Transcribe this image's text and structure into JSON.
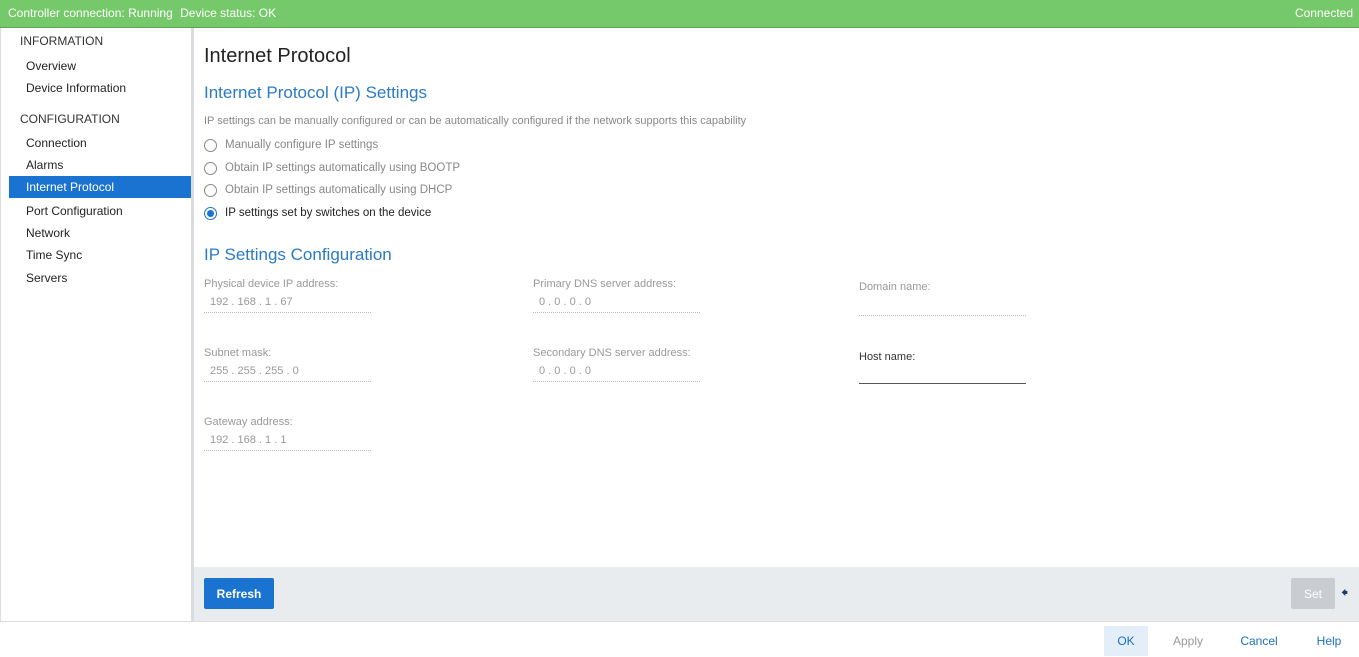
{
  "status": {
    "controller": "Controller connection: Running",
    "device": "Device status: OK",
    "connection": "Connected"
  },
  "sidebar": {
    "information_header": "INFORMATION",
    "configuration_header": "CONFIGURATION",
    "info_items": [
      {
        "label": "Overview"
      },
      {
        "label": "Device Information"
      }
    ],
    "config_items": [
      {
        "label": "Connection"
      },
      {
        "label": "Alarms"
      },
      {
        "label": "Internet Protocol",
        "active": true
      },
      {
        "label": "Port Configuration"
      },
      {
        "label": "Network"
      },
      {
        "label": "Time Sync"
      },
      {
        "label": "Servers"
      }
    ]
  },
  "main": {
    "title": "Internet Protocol",
    "ip_settings_title": "Internet Protocol (IP) Settings",
    "description": "IP settings can be manually configured or can be automatically configured if the network supports this capability",
    "options": [
      {
        "label": "Manually configure IP settings",
        "checked": false
      },
      {
        "label": "Obtain IP settings automatically using BOOTP",
        "checked": false
      },
      {
        "label": "Obtain IP settings automatically using DHCP",
        "checked": false
      },
      {
        "label": "IP settings set by switches on the device",
        "checked": true
      }
    ],
    "config_title": "IP Settings Configuration",
    "fields": {
      "physical_ip_label": "Physical device IP address:",
      "physical_ip_value": "192 . 168 . 1 . 67",
      "subnet_label": "Subnet mask:",
      "subnet_value": "255 . 255 . 255 . 0",
      "gateway_label": "Gateway address:",
      "gateway_value": "192 . 168 . 1 . 1",
      "primary_dns_label": "Primary DNS server address:",
      "primary_dns_value": "0 . 0 . 0 . 0",
      "secondary_dns_label": "Secondary DNS server address:",
      "secondary_dns_value": "0 . 0 . 0 . 0",
      "domain_label": "Domain name:",
      "domain_value": "",
      "host_label": "Host name:",
      "host_value": ""
    }
  },
  "footer": {
    "refresh_label": "Refresh",
    "set_label": "Set",
    "arrow_icon": "arrow-left-icon"
  },
  "bottom_buttons": {
    "ok": "OK",
    "apply": "Apply",
    "cancel": "Cancel",
    "help": "Help"
  }
}
